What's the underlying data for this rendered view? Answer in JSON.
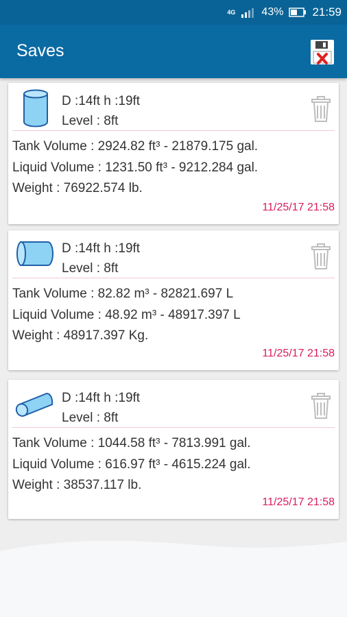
{
  "status_bar": {
    "network": "4G",
    "battery": "43%",
    "time": "21:59"
  },
  "header": {
    "title": "Saves"
  },
  "saves": [
    {
      "shape": "vertical-cylinder",
      "dimensions": "D :14ft h :19ft",
      "level": "Level : 8ft",
      "tank_volume": "Tank Volume : 2924.82 ft³ - 21879.175 gal.",
      "liquid_volume": "Liquid Volume : 1231.50 ft³ - 9212.284 gal.",
      "weight": "Weight : 76922.574 lb.",
      "timestamp": "11/25/17 21:58"
    },
    {
      "shape": "horizontal-cylinder",
      "dimensions": "D :14ft h :19ft",
      "level": "Level : 8ft",
      "tank_volume": "Tank Volume : 82.82 m³ - 82821.697 L",
      "liquid_volume": "Liquid Volume : 48.92 m³ - 48917.397 L",
      "weight": "Weight : 48917.397 Kg.",
      "timestamp": "11/25/17 21:58"
    },
    {
      "shape": "tilted-cylinder",
      "dimensions": "D :14ft h :19ft",
      "level": "Level : 8ft",
      "tank_volume": "Tank Volume : 1044.58 ft³ - 7813.991 gal.",
      "liquid_volume": "Liquid Volume : 616.97 ft³ - 4615.224 gal.",
      "weight": "Weight : 38537.117 lb.",
      "timestamp": "11/25/17 21:58"
    }
  ],
  "colors": {
    "app_bar": "#0a6ba3",
    "status_bar": "#0a6396",
    "timestamp": "#d81b60",
    "tank_fill": "#8fd3f4",
    "tank_outline": "#1f5fa8"
  }
}
